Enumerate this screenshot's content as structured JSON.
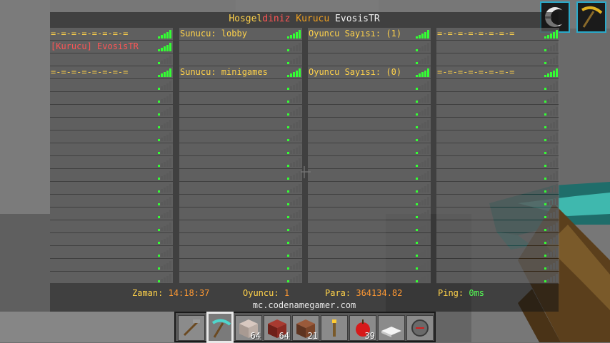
{
  "header": {
    "hos": "Hosgel",
    "diniz": "diniz",
    "kurucu": "Kurucu",
    "name": "EvosisTR"
  },
  "tab_cells": {
    "c0r0": "=-=-=-=-=-=-=-=",
    "c0r1_rank": "[Kurucu]",
    "c0r1_name": "EvosisTR",
    "c0r3": "=-=-=-=-=-=-=-=",
    "c1r0": "Sunucu: lobby",
    "c1r3": "Sunucu: minigames",
    "c2r0": "Oyuncu Sayısı: (1)",
    "c2r3": "Oyuncu Sayısı: (0)",
    "c3r0": "=-=-=-=-=-=-=-=",
    "c3r3": "=-=-=-=-=-=-=-="
  },
  "footer": {
    "time_label": "Zaman:",
    "time_value": "14:18:37",
    "players_label": "Oyuncu:",
    "players_value": "1",
    "money_label": "Para:",
    "money_value": "364134.82",
    "ping_label": "Ping:",
    "ping_value": "0ms",
    "server_address": "mc.codenamegamer.com"
  },
  "hotbar": {
    "selected_slot": 2,
    "slots": [
      {
        "icon": "hoe-icon",
        "count": ""
      },
      {
        "icon": "diamond-pickaxe-icon",
        "count": ""
      },
      {
        "icon": "stone-block-icon",
        "count": "64"
      },
      {
        "icon": "brick-block-icon",
        "count": "64"
      },
      {
        "icon": "dirt-block-icon",
        "count": "21"
      },
      {
        "icon": "torch-icon",
        "count": ""
      },
      {
        "icon": "apple-icon",
        "count": "39"
      },
      {
        "icon": "snow-layer-icon",
        "count": ""
      },
      {
        "icon": "compass-icon",
        "count": ""
      }
    ]
  },
  "effects": [
    "speed-effect-icon",
    "haste-effect-icon"
  ],
  "colors": {
    "signal_full": "#33ff33",
    "signal_empty": "#5a5a5a",
    "header_yellow": "#ffd24a",
    "rank_red": "#ff5555"
  }
}
